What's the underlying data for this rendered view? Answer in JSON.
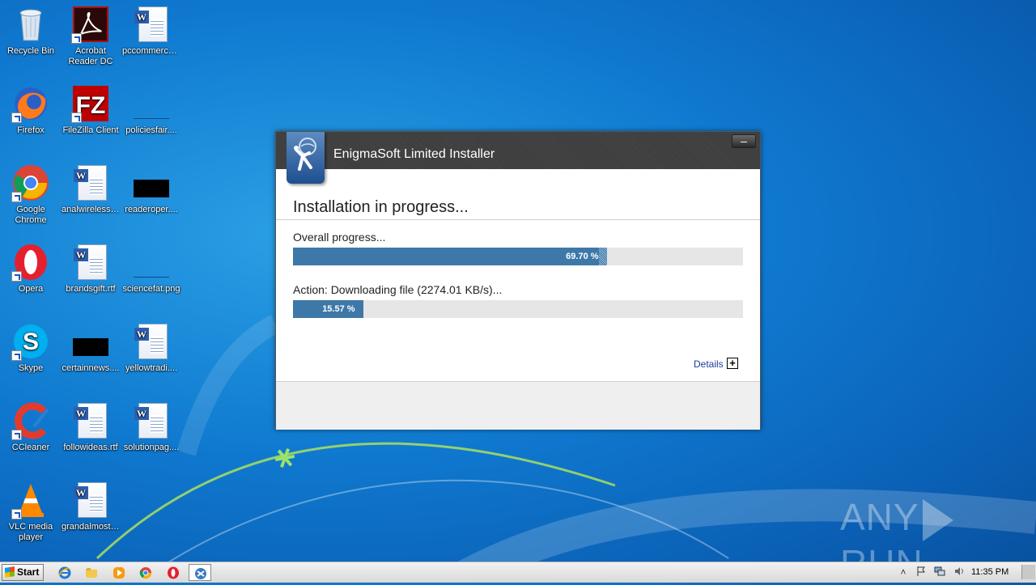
{
  "desktop": {
    "icons": [
      {
        "label": "Recycle Bin"
      },
      {
        "label": "Acrobat Reader DC"
      },
      {
        "label": "pccommerce...."
      },
      {
        "label": "Firefox"
      },
      {
        "label": "FileZilla Client"
      },
      {
        "label": "policiesfair...."
      },
      {
        "label": "Google Chrome"
      },
      {
        "label": "analwireless...."
      },
      {
        "label": "readeroper...."
      },
      {
        "label": "Opera"
      },
      {
        "label": "brandsgift.rtf"
      },
      {
        "label": "sciencefat.png"
      },
      {
        "label": "Skype"
      },
      {
        "label": "certainnews...."
      },
      {
        "label": "yellowtradi...."
      },
      {
        "label": "CCleaner"
      },
      {
        "label": "followideas.rtf"
      },
      {
        "label": "solutionpag...."
      },
      {
        "label": "VLC media player"
      },
      {
        "label": "grandalmost...."
      }
    ]
  },
  "installer": {
    "title": "EnigmaSoft Limited Installer",
    "heading": "Installation in progress...",
    "overall_label": "Overall progress...",
    "overall_percent": 69.7,
    "overall_text": "69.70 %",
    "action_label": "Action: Downloading file (2274.01 KB/s)...",
    "action_percent": 15.57,
    "action_text": "15.57 %",
    "details_label": "Details",
    "details_toggle": "+",
    "minimize_glyph": "–"
  },
  "watermark": {
    "left": "ANY",
    "right": "RUN"
  },
  "taskbar": {
    "start_label": "Start",
    "clock": "11:35 PM",
    "tray_expand": "˄"
  }
}
